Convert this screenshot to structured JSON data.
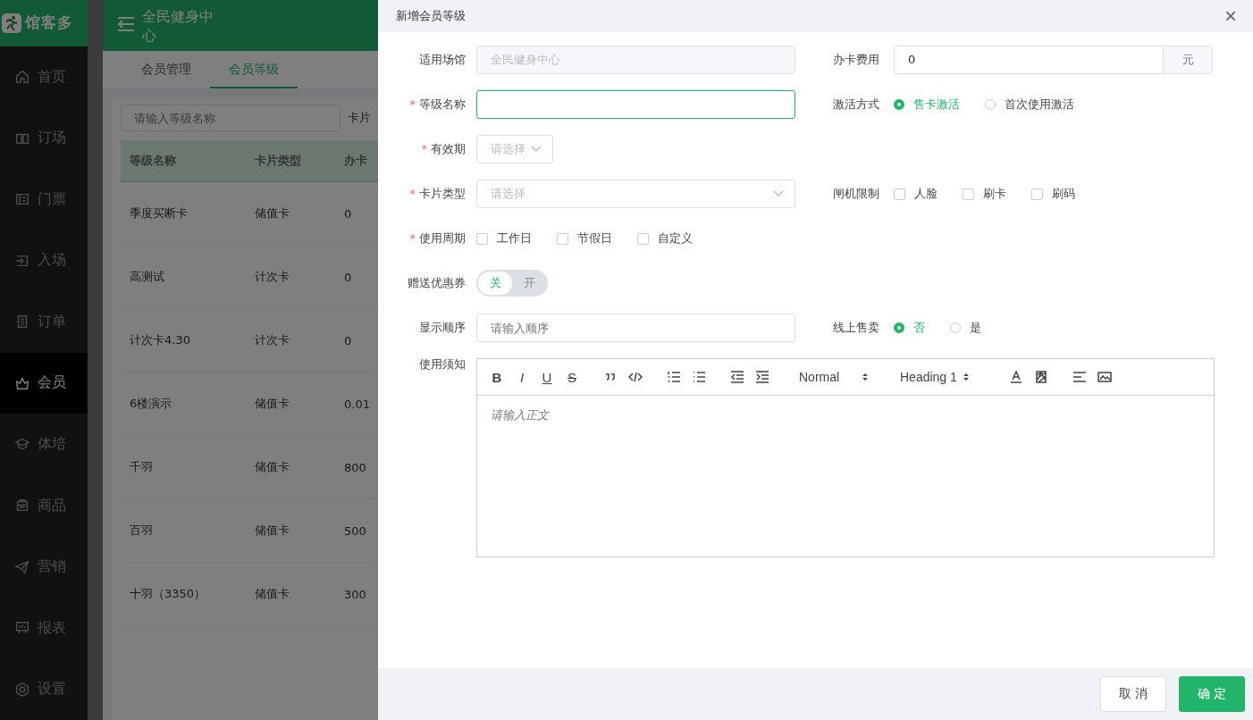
{
  "app": {
    "logo": "馆客多",
    "header_title": "全民健身中心",
    "sidebar": [
      {
        "label": "首页",
        "selected": false
      },
      {
        "label": "订场",
        "selected": false
      },
      {
        "label": "门票",
        "selected": false
      },
      {
        "label": "入场",
        "selected": false
      },
      {
        "label": "订单",
        "selected": false
      },
      {
        "label": "会员",
        "selected": true
      },
      {
        "label": "体培",
        "selected": false
      },
      {
        "label": "商品",
        "selected": false
      },
      {
        "label": "营销",
        "selected": false
      },
      {
        "label": "报表",
        "selected": false
      },
      {
        "label": "设置",
        "selected": false
      }
    ],
    "tabs": [
      {
        "label": "会员管理",
        "selected": false
      },
      {
        "label": "会员等级",
        "selected": true
      }
    ],
    "search": {
      "placeholder": "请输入等级名称"
    },
    "filter_label": "卡片",
    "table": {
      "columns": [
        "等级名称",
        "卡片类型",
        "办卡"
      ],
      "rows": [
        [
          "季度买断卡",
          "储值卡",
          "0"
        ],
        [
          "高测试",
          "计次卡",
          "0"
        ],
        [
          "计次卡4.30",
          "计次卡",
          "0"
        ],
        [
          "6楼演示",
          "储值卡",
          "0.01"
        ],
        [
          "千羽",
          "储值卡",
          "800"
        ],
        [
          "百羽",
          "储值卡",
          "500"
        ],
        [
          "十羽（3350）",
          "储值卡",
          "300"
        ]
      ]
    }
  },
  "drawer": {
    "title": "新增会员等级",
    "close": "×",
    "rows": [
      {
        "left": {
          "label": "适用场馆",
          "kind": "input",
          "value": "全民健身中心",
          "disabled": true
        },
        "right": {
          "label": "办卡费用",
          "kind": "addon",
          "value": "0",
          "addon": "元"
        }
      },
      {
        "left": {
          "label": "等级名称",
          "required_mark": "*",
          "kind": "input",
          "focused": true
        },
        "right": {
          "label": "激活方式",
          "kind": "radio",
          "options": [
            {
              "label": "售卡激活",
              "selected": true
            },
            {
              "label": "首次使用激活",
              "selected": false
            }
          ]
        }
      },
      {
        "left": {
          "label": "有效期",
          "required_mark": "*",
          "kind": "select_short",
          "placeholder": "请选择"
        }
      },
      {
        "left": {
          "label": "卡片类型",
          "required_mark": "*",
          "kind": "select",
          "placeholder": "请选择"
        },
        "right": {
          "label": "闸机限制",
          "kind": "checkbox",
          "options": [
            {
              "label": "人脸",
              "checked": false
            },
            {
              "label": "刷卡",
              "checked": false
            },
            {
              "label": "刷码",
              "checked": false
            }
          ]
        }
      },
      {
        "left": {
          "label": "使用周期",
          "required_mark": "*",
          "kind": "checkbox",
          "options": [
            {
              "label": "工作日",
              "checked": false
            },
            {
              "label": "节假日",
              "checked": false
            },
            {
              "label": "自定义",
              "checked": false
            }
          ]
        }
      },
      {
        "left": {
          "label": "赠送优惠券",
          "kind": "switch",
          "off_label": "关",
          "on_label": "开",
          "on": false
        }
      },
      {
        "left": {
          "label": "显示顺序",
          "kind": "input",
          "placeholder": "请输入顺序"
        },
        "right": {
          "label": "线上售卖",
          "kind": "radio",
          "options": [
            {
              "label": "否",
              "selected": true
            },
            {
              "label": "是",
              "selected": false
            }
          ]
        }
      }
    ],
    "editor": {
      "label": "使用须知",
      "placeholder": "请输入正文",
      "toolbar": [
        [
          {
            "kind": "bold",
            "text": "B"
          },
          {
            "kind": "italic",
            "text": "I"
          },
          {
            "kind": "underline",
            "text": "U"
          },
          {
            "kind": "strike",
            "text": "S"
          }
        ],
        [
          {
            "kind": "quote"
          },
          {
            "kind": "code"
          }
        ],
        [
          {
            "kind": "ol"
          },
          {
            "kind": "ul"
          }
        ],
        [
          {
            "kind": "outdent"
          },
          {
            "kind": "indent"
          }
        ],
        [
          {
            "kind": "select",
            "text": "Normal"
          },
          {
            "kind": "select",
            "text": "Heading 1"
          }
        ],
        [
          {
            "kind": "color"
          },
          {
            "kind": "background"
          }
        ],
        [
          {
            "kind": "align"
          },
          {
            "kind": "image"
          }
        ]
      ]
    },
    "buttons": [
      {
        "label": "取 消",
        "kind": "cancel"
      },
      {
        "label": "确 定",
        "kind": "primary"
      }
    ]
  }
}
